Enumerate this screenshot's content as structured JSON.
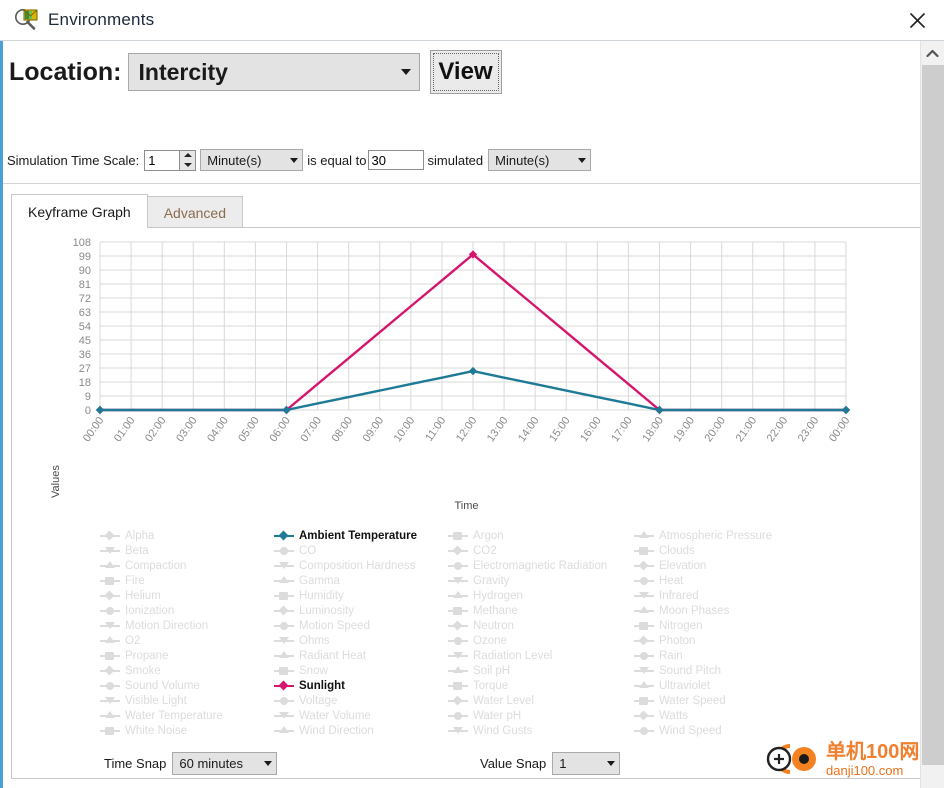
{
  "window": {
    "title": "Environments",
    "icon": "environments-magnifier-icon",
    "close_label": "✕"
  },
  "location_row": {
    "label": "Location:",
    "selected": "Intercity",
    "view_button": "View"
  },
  "sim_row": {
    "label": "Simulation Time Scale:",
    "scale_value": "1",
    "scale_unit": "Minute(s)",
    "middle_text": "is equal to",
    "simulated_value": "30",
    "simulated_text": "simulated",
    "simulated_unit": "Minute(s)"
  },
  "tabs": [
    {
      "label": "Keyframe Graph",
      "active": true
    },
    {
      "label": "Advanced",
      "active": false
    }
  ],
  "snap": {
    "time_label": "Time Snap",
    "time_value": "60 minutes",
    "value_label": "Value Snap",
    "value_value": "1"
  },
  "watermark": {
    "cn": "单机100网",
    "en": "danji100.com"
  },
  "colors": {
    "sunlight": "#d4166e",
    "ambient_temperature": "#1f7a96",
    "inactive_legend": "#dcdcdc",
    "grid": "#d9d9d9",
    "axis_text": "#8a8a8a",
    "accent": "#4a9fd8",
    "watermark_orange": "#f08030"
  },
  "chart_data": {
    "type": "line",
    "title": "",
    "xlabel": "Time",
    "ylabel": "Values",
    "ylim": [
      0,
      108
    ],
    "ytick_step": 9,
    "yticks": [
      0,
      9,
      18,
      27,
      36,
      45,
      54,
      63,
      72,
      81,
      90,
      99,
      108
    ],
    "grid": true,
    "legend_position": "bottom",
    "categories": [
      "00:00",
      "01:00",
      "02:00",
      "03:00",
      "04:00",
      "05:00",
      "06:00",
      "07:00",
      "08:00",
      "09:00",
      "10:00",
      "11:00",
      "12:00",
      "13:00",
      "14:00",
      "15:00",
      "16:00",
      "17:00",
      "18:00",
      "19:00",
      "20:00",
      "21:00",
      "22:00",
      "23:00",
      "00:00"
    ],
    "keyframe_x": [
      "00:00",
      "06:00",
      "12:00",
      "18:00",
      "00:00"
    ],
    "series": [
      {
        "name": "Sunlight",
        "color": "#d4166e",
        "marker": "diamond",
        "keyframe_values": [
          0,
          0,
          100,
          0,
          0
        ],
        "values": [
          0,
          0,
          0,
          0,
          0,
          0,
          0,
          16.7,
          33.3,
          50,
          66.7,
          83.3,
          100,
          83.3,
          66.7,
          50,
          33.3,
          16.7,
          0,
          0,
          0,
          0,
          0,
          0,
          0
        ]
      },
      {
        "name": "Ambient Temperature",
        "color": "#1f7a96",
        "marker": "diamond",
        "keyframe_values": [
          0,
          0,
          25,
          0,
          0
        ],
        "values": [
          0,
          0,
          0,
          0,
          0,
          0,
          0,
          4.2,
          8.3,
          12.5,
          16.7,
          20.8,
          25,
          20.8,
          16.7,
          12.5,
          8.3,
          4.2,
          0,
          0,
          0,
          0,
          0,
          0,
          0
        ]
      }
    ],
    "legend_columns": [
      [
        {
          "label": "Alpha",
          "active": false,
          "marker": "diamond"
        },
        {
          "label": "Beta",
          "active": false,
          "marker": "tri-dn"
        },
        {
          "label": "Compaction",
          "active": false,
          "marker": "tri-up"
        },
        {
          "label": "Fire",
          "active": false,
          "marker": "square"
        },
        {
          "label": "Helium",
          "active": false,
          "marker": "diamond"
        },
        {
          "label": "Ionization",
          "active": false,
          "marker": "circle"
        },
        {
          "label": "Motion Direction",
          "active": false,
          "marker": "tri-dn"
        },
        {
          "label": "O2",
          "active": false,
          "marker": "tri-up"
        },
        {
          "label": "Propane",
          "active": false,
          "marker": "square"
        },
        {
          "label": "Smoke",
          "active": false,
          "marker": "diamond"
        },
        {
          "label": "Sound Volume",
          "active": false,
          "marker": "circle"
        },
        {
          "label": "Visible Light",
          "active": false,
          "marker": "tri-dn"
        },
        {
          "label": "Water Temperature",
          "active": false,
          "marker": "tri-up"
        },
        {
          "label": "White Noise",
          "active": false,
          "marker": "square"
        }
      ],
      [
        {
          "label": "Ambient Temperature",
          "active": true,
          "marker": "diamond"
        },
        {
          "label": "CO",
          "active": false,
          "marker": "circle"
        },
        {
          "label": "Composition Hardness",
          "active": false,
          "marker": "tri-dn"
        },
        {
          "label": "Gamma",
          "active": false,
          "marker": "tri-up"
        },
        {
          "label": "Humidity",
          "active": false,
          "marker": "square"
        },
        {
          "label": "Luminosity",
          "active": false,
          "marker": "diamond"
        },
        {
          "label": "Motion Speed",
          "active": false,
          "marker": "circle"
        },
        {
          "label": "Ohms",
          "active": false,
          "marker": "tri-dn"
        },
        {
          "label": "Radiant Heat",
          "active": false,
          "marker": "tri-up"
        },
        {
          "label": "Snow",
          "active": false,
          "marker": "square"
        },
        {
          "label": "Sunlight",
          "active": true,
          "marker": "diamond"
        },
        {
          "label": "Voltage",
          "active": false,
          "marker": "circle"
        },
        {
          "label": "Water Volume",
          "active": false,
          "marker": "tri-dn"
        },
        {
          "label": "Wind Direction",
          "active": false,
          "marker": "tri-up"
        }
      ],
      [
        {
          "label": "Argon",
          "active": false,
          "marker": "square"
        },
        {
          "label": "CO2",
          "active": false,
          "marker": "diamond"
        },
        {
          "label": "Electromagnetic Radiation",
          "active": false,
          "marker": "circle"
        },
        {
          "label": "Gravity",
          "active": false,
          "marker": "tri-dn"
        },
        {
          "label": "Hydrogen",
          "active": false,
          "marker": "tri-up"
        },
        {
          "label": "Methane",
          "active": false,
          "marker": "square"
        },
        {
          "label": "Neutron",
          "active": false,
          "marker": "diamond"
        },
        {
          "label": "Ozone",
          "active": false,
          "marker": "circle"
        },
        {
          "label": "Radiation Level",
          "active": false,
          "marker": "tri-dn"
        },
        {
          "label": "Soil pH",
          "active": false,
          "marker": "tri-up"
        },
        {
          "label": "Torque",
          "active": false,
          "marker": "square"
        },
        {
          "label": "Water Level",
          "active": false,
          "marker": "diamond"
        },
        {
          "label": "Water pH",
          "active": false,
          "marker": "circle"
        },
        {
          "label": "Wind Gusts",
          "active": false,
          "marker": "tri-dn"
        }
      ],
      [
        {
          "label": "Atmospheric Pressure",
          "active": false,
          "marker": "tri-up"
        },
        {
          "label": "Clouds",
          "active": false,
          "marker": "square"
        },
        {
          "label": "Elevation",
          "active": false,
          "marker": "diamond"
        },
        {
          "label": "Heat",
          "active": false,
          "marker": "circle"
        },
        {
          "label": "Infrared",
          "active": false,
          "marker": "tri-dn"
        },
        {
          "label": "Moon Phases",
          "active": false,
          "marker": "tri-up"
        },
        {
          "label": "Nitrogen",
          "active": false,
          "marker": "square"
        },
        {
          "label": "Photon",
          "active": false,
          "marker": "diamond"
        },
        {
          "label": "Rain",
          "active": false,
          "marker": "circle"
        },
        {
          "label": "Sound Pitch",
          "active": false,
          "marker": "tri-dn"
        },
        {
          "label": "Ultraviolet",
          "active": false,
          "marker": "tri-up"
        },
        {
          "label": "Water Speed",
          "active": false,
          "marker": "square"
        },
        {
          "label": "Watts",
          "active": false,
          "marker": "diamond"
        },
        {
          "label": "Wind Speed",
          "active": false,
          "marker": "circle"
        }
      ]
    ]
  }
}
